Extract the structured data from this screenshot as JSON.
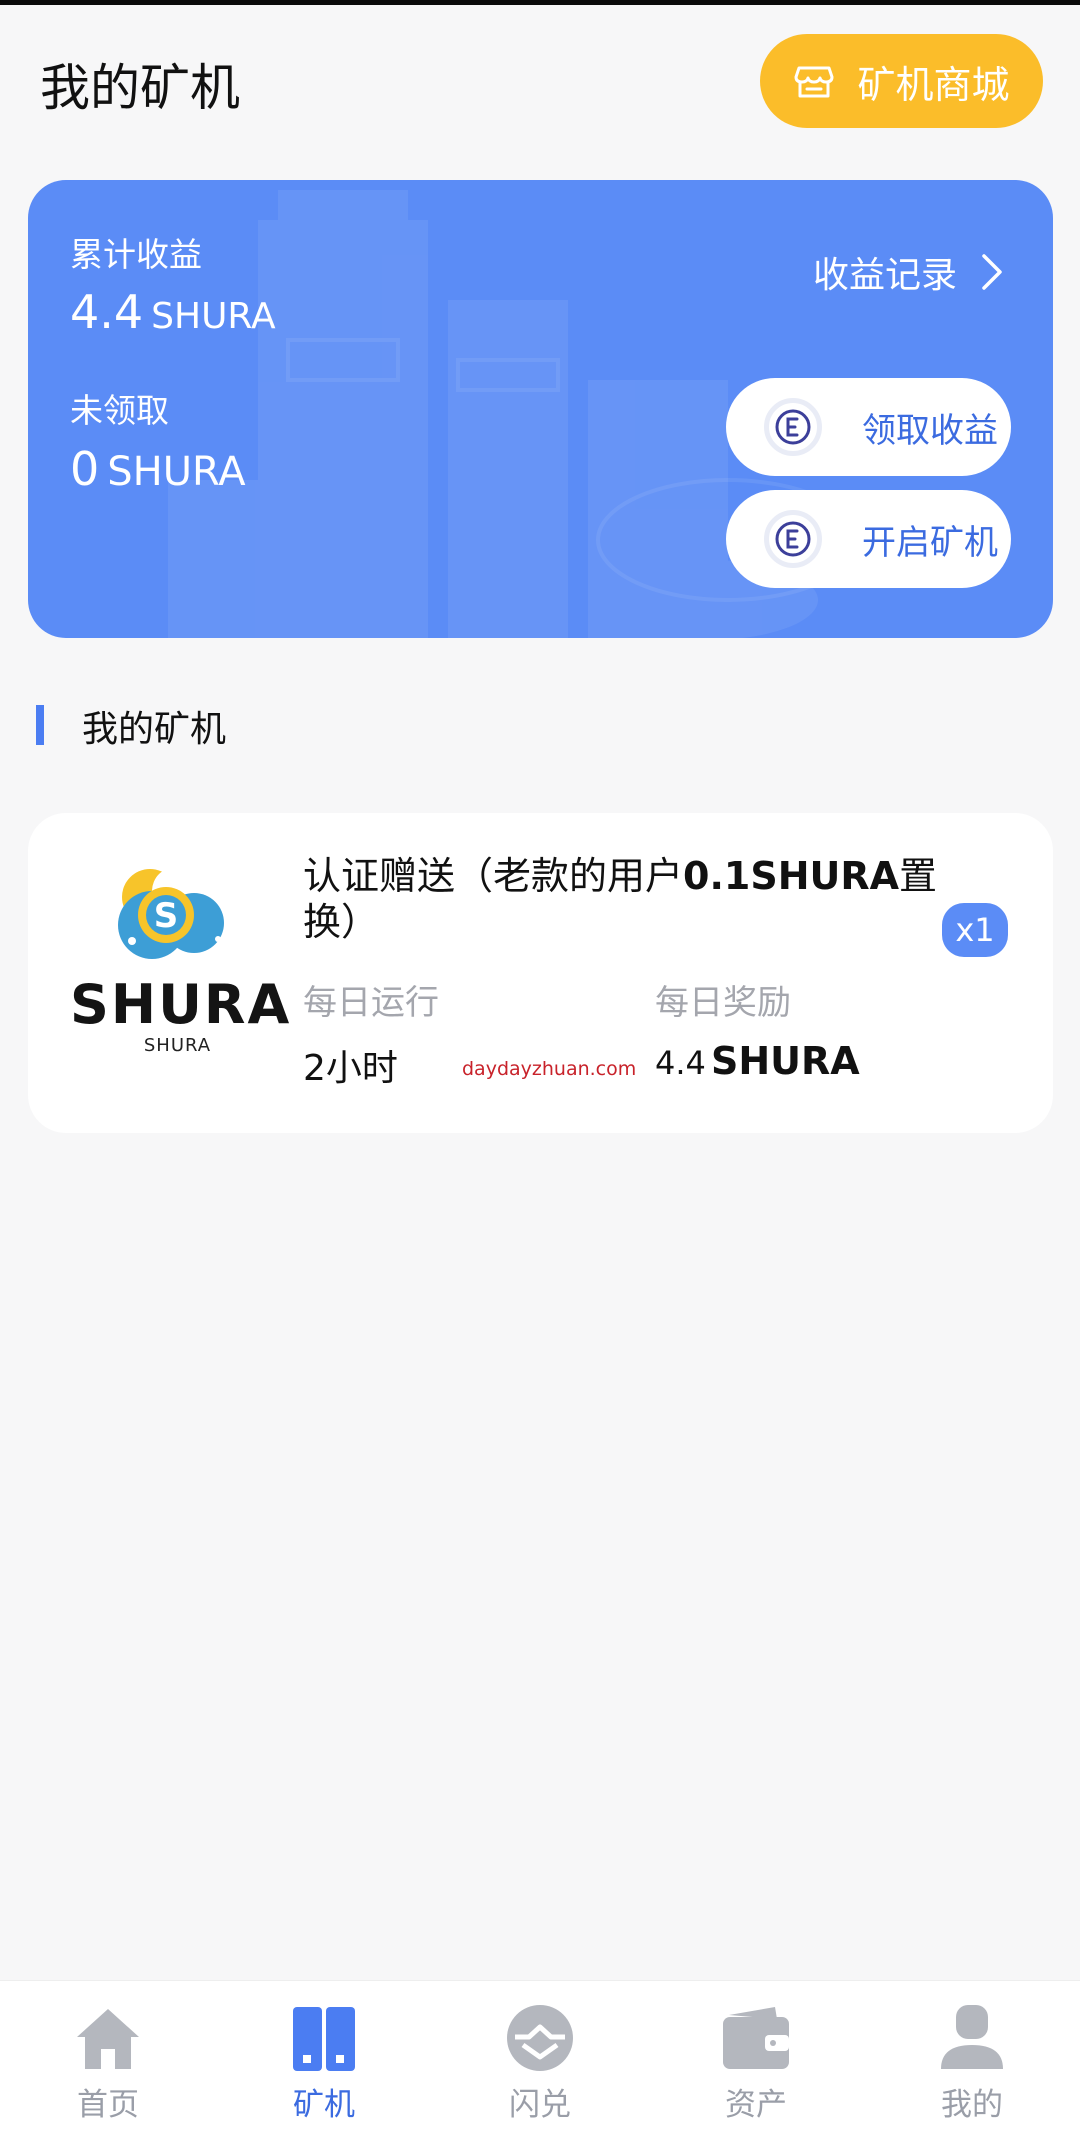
{
  "header": {
    "title": "我的矿机",
    "shop_button": {
      "label": "矿机商城",
      "icon": "store-icon"
    }
  },
  "earnings": {
    "total_label": "累计收益",
    "total_value": "4.4",
    "total_unit": "SHURA",
    "records_label": "收益记录",
    "unclaimed_label": "未领取",
    "unclaimed_value": "0",
    "unclaimed_unit": "SHURA",
    "claim_button": {
      "label": "领取收益",
      "icon": "coin-icon"
    },
    "start_button": {
      "label": "开启矿机",
      "icon": "coin-icon"
    },
    "card_color": "#5b8cf6"
  },
  "section": {
    "title": "我的矿机"
  },
  "miner": {
    "logo_text": "SHURA",
    "logo_subtext": "SHURA",
    "name_prefix": "认证赠送（老款的用户",
    "name_bold": "0.1SHURA",
    "name_suffix": "置换）",
    "count_badge": "x1",
    "daily_run_label": "每日运行",
    "daily_run_number": "2",
    "daily_run_unit": "小时",
    "daily_reward_label": "每日奖励",
    "daily_reward_number": "4.4",
    "daily_reward_unit": "SHURA",
    "watermark": "daydayzhuan.com"
  },
  "bottom_nav": {
    "items": [
      {
        "label": "首页",
        "icon": "home-icon",
        "active": false
      },
      {
        "label": "矿机",
        "icon": "miner-icon",
        "active": true
      },
      {
        "label": "闪兑",
        "icon": "exchange-icon",
        "active": false
      },
      {
        "label": "资产",
        "icon": "wallet-icon",
        "active": false
      },
      {
        "label": "我的",
        "icon": "profile-icon",
        "active": false
      }
    ]
  },
  "colors": {
    "accent": "#3b6be0",
    "shop_button": "#fbbd2a",
    "inactive_nav": "#9a9ea8"
  }
}
